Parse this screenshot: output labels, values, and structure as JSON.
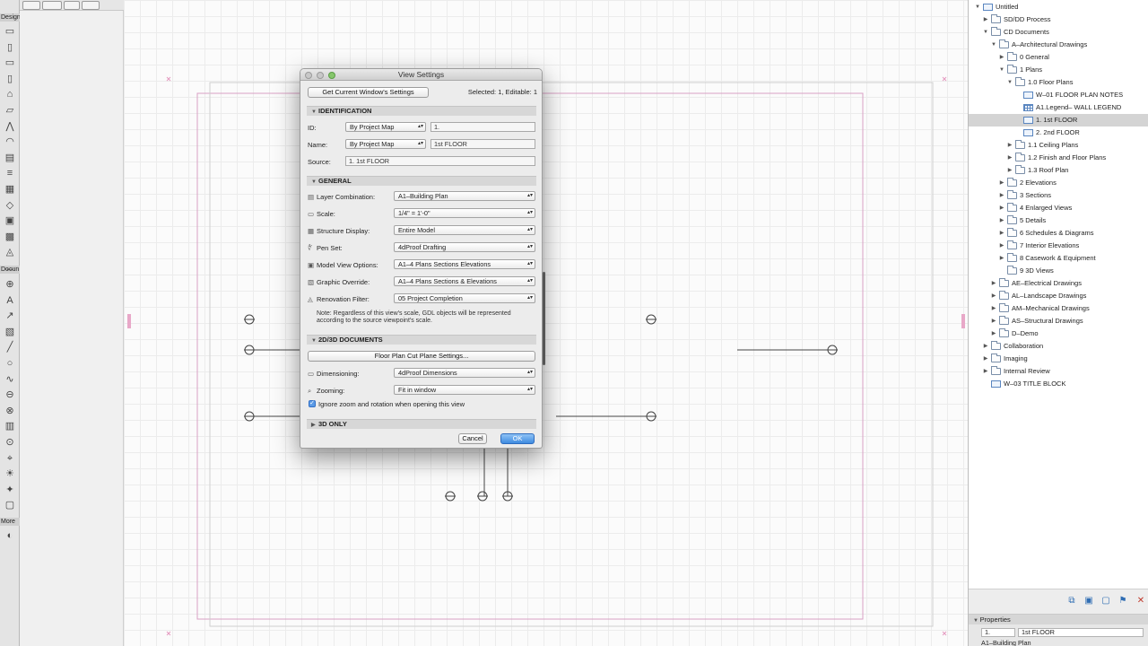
{
  "toolbox": {
    "sections": [
      "Design",
      "Docun",
      "More"
    ],
    "icons": [
      "wall-tool",
      "column-tool",
      "beam-tool",
      "window-tool",
      "door-tool",
      "slab-tool",
      "roof-tool",
      "shell-tool",
      "stair-tool",
      "railing-tool",
      "curtain-wall-tool",
      "morph-tool",
      "object-tool",
      "zone-tool",
      "mesh-tool",
      "dimension-tool",
      "level-tool",
      "text-tool",
      "label-tool",
      "fill-tool",
      "line-tool",
      "circle-tool",
      "spline-tool",
      "section-tool",
      "elevation-tool",
      "worksheet-tool",
      "detail-tool",
      "camera-tool",
      "lamp-tool",
      "hotspot-tool",
      "drawing-tool",
      "figure-tool"
    ]
  },
  "dialog": {
    "title": "View Settings",
    "get_button": "Get Current Window's Settings",
    "selected_info": "Selected: 1, Editable: 1",
    "identification": {
      "header": "IDENTIFICATION",
      "id_label": "ID:",
      "id_mode": "By Project Map",
      "id_value": "1.",
      "name_label": "Name:",
      "name_mode": "By Project Map",
      "name_value": "1st FLOOR",
      "source_label": "Source:",
      "source_value": "1. 1st FLOOR"
    },
    "general": {
      "header": "GENERAL",
      "rows": [
        {
          "label": "Layer Combination:",
          "value": "A1–Building Plan"
        },
        {
          "label": "Scale:",
          "value": "1/4\"   =    1'-0\""
        },
        {
          "label": "Structure Display:",
          "value": "Entire Model"
        },
        {
          "label": "Pen Set:",
          "value": "4dProof Drafting"
        },
        {
          "label": "Model View Options:",
          "value": "A1–4 Plans Sections Elevations"
        },
        {
          "label": "Graphic Override:",
          "value": "A1–4 Plans Sections & Elevations"
        },
        {
          "label": "Renovation Filter:",
          "value": "05 Project Completion"
        }
      ],
      "note": "Note: Regardless of this view's scale, GDL objects will be represented according to the source viewpoint's scale."
    },
    "docs2d3d": {
      "header": "2D/3D DOCUMENTS",
      "cut_plane_button": "Floor Plan Cut Plane Settings...",
      "dimensioning_label": "Dimensioning:",
      "dimensioning_value": "4dProof Dimensions",
      "zooming_label": "Zooming:",
      "zooming_value": "Fit in window",
      "ignore_zoom_label": "Ignore zoom and rotation when opening this view"
    },
    "only3d_header": "3D ONLY",
    "cancel_label": "Cancel",
    "ok_label": "OK"
  },
  "navigator": {
    "items": [
      {
        "label": "Untitled",
        "type": "root",
        "depth": 0,
        "expanded": true
      },
      {
        "label": "SD/DD Process",
        "type": "folder",
        "depth": 1,
        "expanded": false
      },
      {
        "label": "CD Documents",
        "type": "folder",
        "depth": 1,
        "expanded": true
      },
      {
        "label": "A–Architectural Drawings",
        "type": "folder",
        "depth": 2,
        "expanded": true
      },
      {
        "label": "0 General",
        "type": "folder",
        "depth": 3,
        "expanded": false
      },
      {
        "label": "1 Plans",
        "type": "folder",
        "depth": 3,
        "expanded": true
      },
      {
        "label": "1.0 Floor Plans",
        "type": "folder",
        "depth": 4,
        "expanded": true
      },
      {
        "label": "W–01 FLOOR PLAN NOTES",
        "type": "view",
        "depth": 5
      },
      {
        "label": "A1.Legend– WALL LEGEND",
        "type": "grid",
        "depth": 5
      },
      {
        "label": "1. 1st FLOOR",
        "type": "view",
        "depth": 5,
        "selected": true
      },
      {
        "label": "2. 2nd FLOOR",
        "type": "view",
        "depth": 5
      },
      {
        "label": "1.1 Ceiling Plans",
        "type": "folder",
        "depth": 4,
        "expanded": false
      },
      {
        "label": "1.2 Finish and Floor Plans",
        "type": "folder",
        "depth": 4,
        "expanded": false
      },
      {
        "label": "1.3 Roof Plan",
        "type": "folder",
        "depth": 4,
        "expanded": false
      },
      {
        "label": "2 Elevations",
        "type": "folder",
        "depth": 3,
        "expanded": false
      },
      {
        "label": "3 Sections",
        "type": "folder",
        "depth": 3,
        "expanded": false
      },
      {
        "label": "4 Enlarged Views",
        "type": "folder",
        "depth": 3,
        "expanded": false
      },
      {
        "label": "5 Details",
        "type": "folder",
        "depth": 3,
        "expanded": false
      },
      {
        "label": "6 Schedules & Diagrams",
        "type": "folder",
        "depth": 3,
        "expanded": false
      },
      {
        "label": "7 Interior Elevations",
        "type": "folder",
        "depth": 3,
        "expanded": false
      },
      {
        "label": "8 Casework & Equipment",
        "type": "folder",
        "depth": 3,
        "expanded": false
      },
      {
        "label": "9 3D Views",
        "type": "folder",
        "depth": 3
      },
      {
        "label": "AE–Electrical Drawings",
        "type": "folder",
        "depth": 2,
        "expanded": false
      },
      {
        "label": "AL–Landscape Drawings",
        "type": "folder",
        "depth": 2,
        "expanded": false
      },
      {
        "label": "AM–Mechanical Drawings",
        "type": "folder",
        "depth": 2,
        "expanded": false
      },
      {
        "label": "AS–Structural Drawings",
        "type": "folder",
        "depth": 2,
        "expanded": false
      },
      {
        "label": "D–Demo",
        "type": "folder",
        "depth": 2,
        "expanded": false
      },
      {
        "label": "Collaboration",
        "type": "folder",
        "depth": 1,
        "expanded": false
      },
      {
        "label": "Imaging",
        "type": "folder",
        "depth": 1,
        "expanded": false
      },
      {
        "label": "Internal Review",
        "type": "folder",
        "depth": 1,
        "expanded": false
      },
      {
        "label": "W–03 TITLE BLOCK",
        "type": "view",
        "depth": 1
      }
    ]
  },
  "properties": {
    "header": "Properties",
    "id_value": "1.",
    "name_value": "1st FLOOR",
    "layer_value": "A1–Building Plan"
  }
}
